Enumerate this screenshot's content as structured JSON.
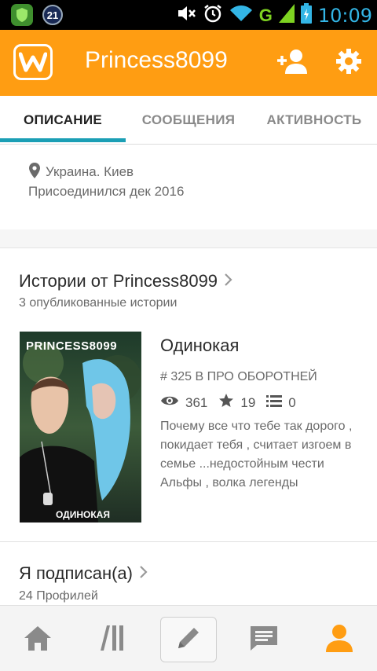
{
  "status_bar": {
    "badge_count": "21",
    "network": "G",
    "time": "10:09"
  },
  "app_bar": {
    "title": "Princess8099",
    "accent_color": "#ff9d12"
  },
  "tabs": [
    {
      "label": "ОПИСАНИЕ",
      "active": true
    },
    {
      "label": "СООБЩЕНИЯ",
      "active": false
    },
    {
      "label": "АКТИВНОСТЬ",
      "active": false
    }
  ],
  "about": {
    "location": "Украина. Киев",
    "joined": "Присоединился дек 2016"
  },
  "stories": {
    "title": "Истории от Princess8099",
    "subtitle": "3 опубликованные истории",
    "item": {
      "cover_top_text": "PRINCESS8099",
      "cover_bottom_text": "ОДИНОКАЯ",
      "title": "Одинокая",
      "rank": "# 325 В ПРО ОБОРОТНЕЙ",
      "views": "361",
      "votes": "19",
      "parts": "0",
      "description": [
        "Почему все что тебе так дорого ,",
        "покидает тебя , считает изгоем в",
        "семье ...недостойным чести",
        "Альфы , волка легенды"
      ]
    }
  },
  "following": {
    "title": "Я подписан(а)",
    "subtitle": "24 Профилей"
  },
  "bottom_nav": [
    "home-icon",
    "library-icon",
    "write-icon",
    "messages-icon",
    "profile-icon"
  ]
}
